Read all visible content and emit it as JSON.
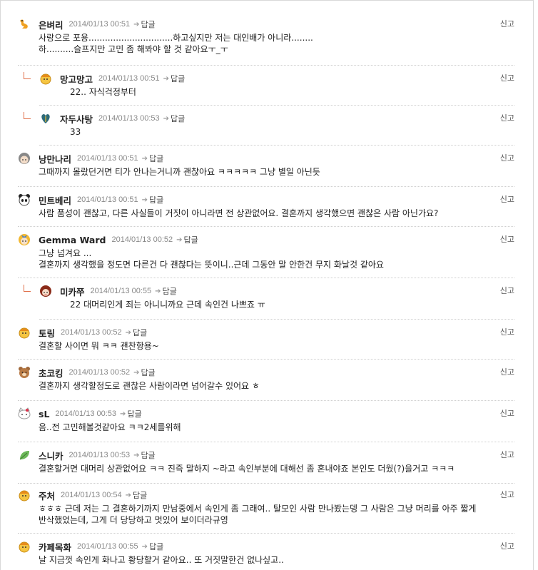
{
  "report_label": "신고",
  "reply_label": "답글",
  "comments": [
    {
      "name": "은벼리",
      "date": "2014/01/13 00:51",
      "avatar": "bird-icon",
      "text": "사랑으로 포용...............................하고싶지만 저는 대인배가 아니라........\n하..........슬프지만 고민 좀 해봐야 할 것 같아요ㅜ_ㅜ"
    },
    {
      "name": "망고망고",
      "date": "2014/01/13 00:51",
      "avatar": "face-icon",
      "text": "22.. 자식걱정부터"
    },
    {
      "name": "자두사탕",
      "date": "2014/01/13 00:53",
      "avatar": "leaf-heart-icon",
      "text": "33"
    },
    {
      "name": "낭만나리",
      "date": "2014/01/13 00:51",
      "avatar": "girl-icon",
      "text": "그때까지 몰랐던거면 티가 안나는거니까 괜찮아요 ㅋㅋㅋㅋㅋ 그냥 별일 아닌듯"
    },
    {
      "name": "민트베리",
      "date": "2014/01/13 00:51",
      "avatar": "panda-icon",
      "text": "사람 품성이 괜찮고, 다른 사실들이 거짓이 아니라면 전 상관없어요. 결혼까지 생각했으면 괜찮은 사람 아닌가요?"
    },
    {
      "name": "Gemma Ward",
      "date": "2014/01/13 00:52",
      "avatar": "blonde-girl-icon",
      "text": "그냥 넘겨요 ...\n결혼까지 생각했을 정도면 다른건 다 괜찮다는 뜻이니..근데 그동안 말 안한건 무지 화날것 같아요"
    },
    {
      "name": "미카쭈",
      "date": "2014/01/13 00:55",
      "avatar": "redhair-icon",
      "text": "22 대머리인게 죄는 아니니까요 근데 속인건 나쁘죠 ㅠ"
    },
    {
      "name": "토링",
      "date": "2014/01/13 00:52",
      "avatar": "face-icon",
      "text": "결혼할 사이면 뭐 ㅋㅋ 괜찬항용~"
    },
    {
      "name": "초코킹",
      "date": "2014/01/13 00:52",
      "avatar": "bear-icon",
      "text": "결혼까지 생각할정도로 괜찮은 사람이라면 넘어갈수 있어요 ㅎ"
    },
    {
      "name": "sL",
      "date": "2014/01/13 00:53",
      "avatar": "kitty-icon",
      "text": "음..전 고민해볼것같아요 ㅋㅋ2세를위해"
    },
    {
      "name": "스니카",
      "date": "2014/01/13 00:53",
      "avatar": "leaf-icon",
      "text": "결혼할거면 대머리 상관없어요 ㅋㅋ 진즉 말하지 ~라고 속인부분에 대해선 좀 혼내야죠 본인도 더웠(?)을거고 ㅋㅋㅋ"
    },
    {
      "name": "주처",
      "date": "2014/01/13 00:54",
      "avatar": "face-icon",
      "text": "ㅎㅎㅎ 근데 저는 그 결혼하기까지 만남중에서 속인게 좀 그래여.. 탈모인 사람 만나봤는뎅 그 사람은 그냥 머리를 아주 짧게\n반삭했었는데, 그게 더 당당하고 멋있어 보이더라규영"
    },
    {
      "name": "카페목화",
      "date": "2014/01/13 00:55",
      "avatar": "face-icon",
      "text": "날 지금껏 속인게 화나고 황당할거 같아요.. 또 거짓말한건 없나싶고.."
    }
  ]
}
